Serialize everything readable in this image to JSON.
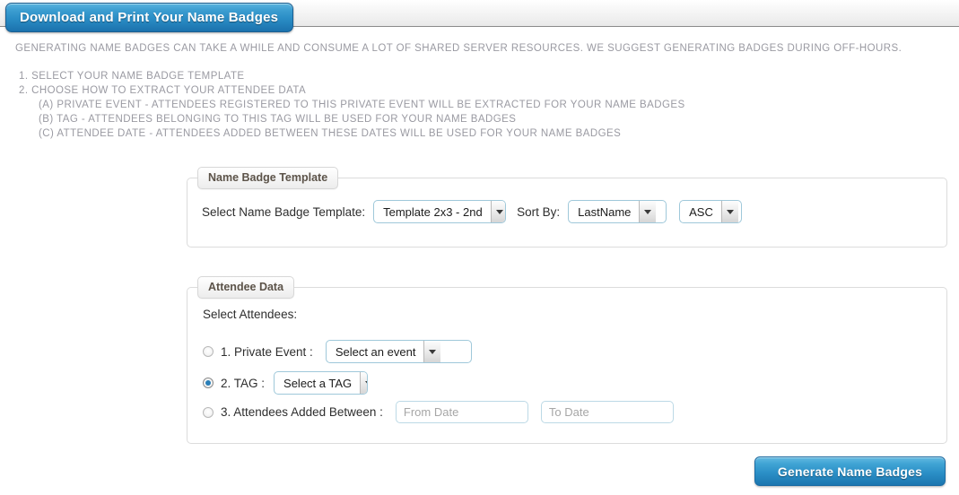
{
  "header": {
    "title": "Download and Print Your Name Badges"
  },
  "intro": {
    "notice": "Generating name badges can take a while and consume a lot of shared server resources. We suggest generating badges during off-hours.",
    "steps": [
      "1. Select your name badge template",
      "2. Choose how to extract your attendee data"
    ],
    "substeps": [
      "(A) Private Event - Attendees registered to this private event will be extracted for your name badges",
      "(B) TAG - Attendees belonging to this tag will be used for your name badges",
      "(C) Attendee Date - Attendees added between these dates will be used for your name badges"
    ]
  },
  "template_section": {
    "legend": "Name Badge Template",
    "template_label": "Select Name Badge Template:",
    "template_value": "Template 2x3 - 2nd",
    "sort_by_label": "Sort By:",
    "sort_by_value": "LastName",
    "sort_order_value": "ASC"
  },
  "attendee_section": {
    "legend": "Attendee Data",
    "select_attendees_label": "Select Attendees:",
    "option_private_label": "1. Private Event :",
    "option_private_value": "Select an event",
    "option_tag_label": "2. TAG :",
    "option_tag_value": "Select a TAG",
    "option_dates_label": "3. Attendees Added Between :",
    "from_date_value": "",
    "from_date_placeholder": "From Date",
    "to_date_value": "",
    "to_date_placeholder": "To Date",
    "selected_option": "tag"
  },
  "footer": {
    "generate_label": "Generate Name Badges"
  },
  "colors": {
    "accent_blue": "#2b8ec6",
    "accent_blue_dark": "#1b72ad",
    "intro_text": "#9a9aa2",
    "legend_text": "#5c5349",
    "select_border": "#9fc8da"
  }
}
